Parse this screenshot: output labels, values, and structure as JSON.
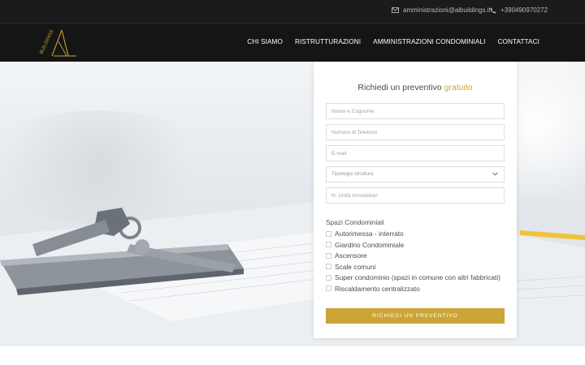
{
  "topbar": {
    "email": "amministrazioni@albuildings.it",
    "phone": "+390490970272"
  },
  "brand": {
    "logo_text": "BUILDINGS",
    "accent_color": "#d4a33a"
  },
  "nav": {
    "items": [
      "CHI SIAMO",
      "RISTRUTTURAZIONI",
      "AMMINISTRAZIONI CONDOMINIALI",
      "CONTATTACI"
    ]
  },
  "form": {
    "title_prefix": "Richiedi un preventivo",
    "title_accent": "gratuito",
    "name_placeholder": "Nome e Cognome",
    "phone_placeholder": "Numero di Telefono",
    "email_placeholder": "E-mail",
    "structure_selected": "Tipologia struttura",
    "units_placeholder": "N. Unità Immobiliari",
    "spaces_title": "Spazi Condominiali",
    "spaces": [
      "Autorimessa - interrato",
      "Giardino Condominiale",
      "Ascensore",
      "Scale comuni",
      "Super condominio (spazi in comune con altri fabbricati)",
      "Riscaldamento centralizzato"
    ],
    "submit_label": "RICHIEDI UN PREVENTIVO"
  },
  "icons": {
    "email": "envelope-icon",
    "phone": "phone-icon",
    "select": "chevron-down-icon"
  }
}
